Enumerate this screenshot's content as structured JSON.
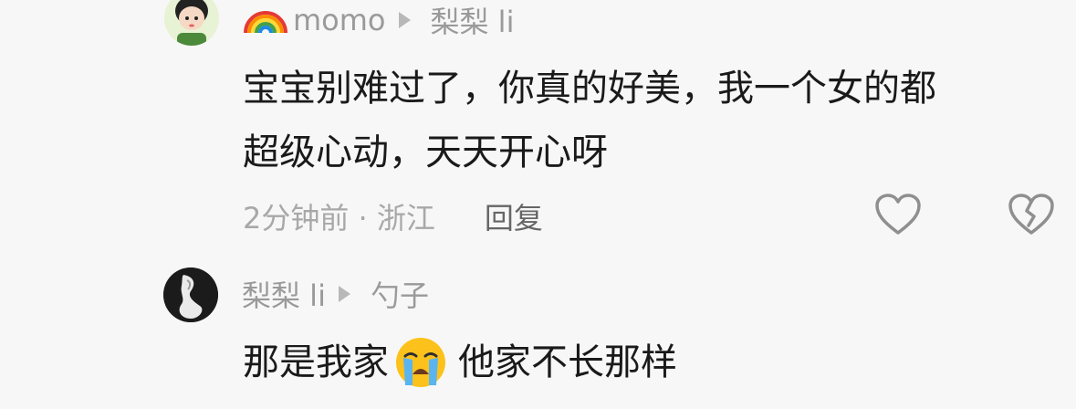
{
  "comments": [
    {
      "author": "momo",
      "reply_to": "梨梨 li",
      "text_line1": "宝宝别难过了，你真的好美，我一个女的都",
      "text_line2": "超级心动，天天开心呀",
      "time_location": "2分钟前 · 浙江",
      "reply_label": "回复",
      "author_prefix_icon": "rainbow-icon"
    },
    {
      "author": "梨梨 li",
      "reply_to": "勺子",
      "text_before_emoji": "那是我家",
      "emoji": "loudly-crying-face-emoji",
      "text_after_emoji": "他家不长那样"
    }
  ],
  "icons": {
    "like": "heart-outline-icon",
    "dislike": "broken-heart-icon",
    "reply_arrow": "triangle-right-icon"
  },
  "colors": {
    "background": "#f7f7f7",
    "meta_text": "#9a9a9a",
    "body_text": "#1a1a1a",
    "icon_stroke": "#8f8f8f"
  }
}
